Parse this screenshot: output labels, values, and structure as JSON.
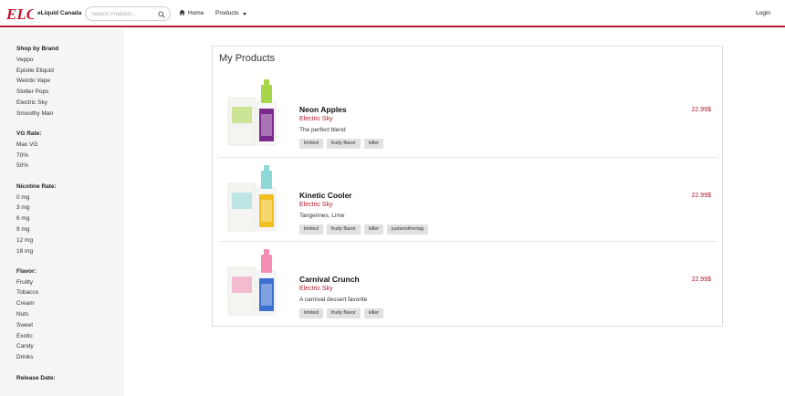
{
  "header": {
    "logo_text": "ELC",
    "brand": "eLiquid Canada",
    "search_placeholder": "Search Products...",
    "nav": {
      "home": "Home",
      "products": "Products"
    },
    "login": "Login",
    "accent_color": "#b01c2e"
  },
  "sidebar": {
    "groups": [
      {
        "title": "Shop by Brand",
        "items": [
          "Veppo",
          "Epistle Eliquid",
          "Weirdo Vape",
          "Slotter Pops",
          "Electric Sky",
          "Smoothy Man"
        ]
      },
      {
        "title": "VG Rate:",
        "items": [
          "Max VG",
          "70%",
          "50%"
        ]
      },
      {
        "title": "Nicotine Rate:",
        "items": [
          "0 mg",
          "3 mg",
          "6 mg",
          "9 mg",
          "12 mg",
          "18 mg"
        ]
      },
      {
        "title": "Flavor:",
        "items": [
          "Fruitty",
          "Tobacco",
          "Cream",
          "Nuts",
          "Sweet",
          "Exotic",
          "Candy",
          "Drinks"
        ]
      },
      {
        "title": "Release Date:",
        "items": []
      }
    ]
  },
  "main": {
    "title": "My Products",
    "products": [
      {
        "name": "Neon Apples",
        "brand": "Electric Sky",
        "description": "The perfect blend",
        "price": "22.99$",
        "tags": [
          "limited",
          "fruity flavor",
          "killer"
        ],
        "bottle_color": "#a8d64a",
        "label_color": "#7a2a8c"
      },
      {
        "name": "Kinetic Cooler",
        "brand": "Electric Sky",
        "description": "Tangerines, Lime",
        "price": "22.99$",
        "tags": [
          "limited",
          "fruity flavor",
          "killer",
          "justanothertag"
        ],
        "bottle_color": "#8fd8d8",
        "label_color": "#f0c020"
      },
      {
        "name": "Carnival Crunch",
        "brand": "Electric Sky",
        "description": "A carnival dessert favorite",
        "price": "22.99$",
        "tags": [
          "limited",
          "fruity flavor",
          "killer"
        ],
        "bottle_color": "#f28db5",
        "label_color": "#3b6fd0"
      }
    ]
  }
}
